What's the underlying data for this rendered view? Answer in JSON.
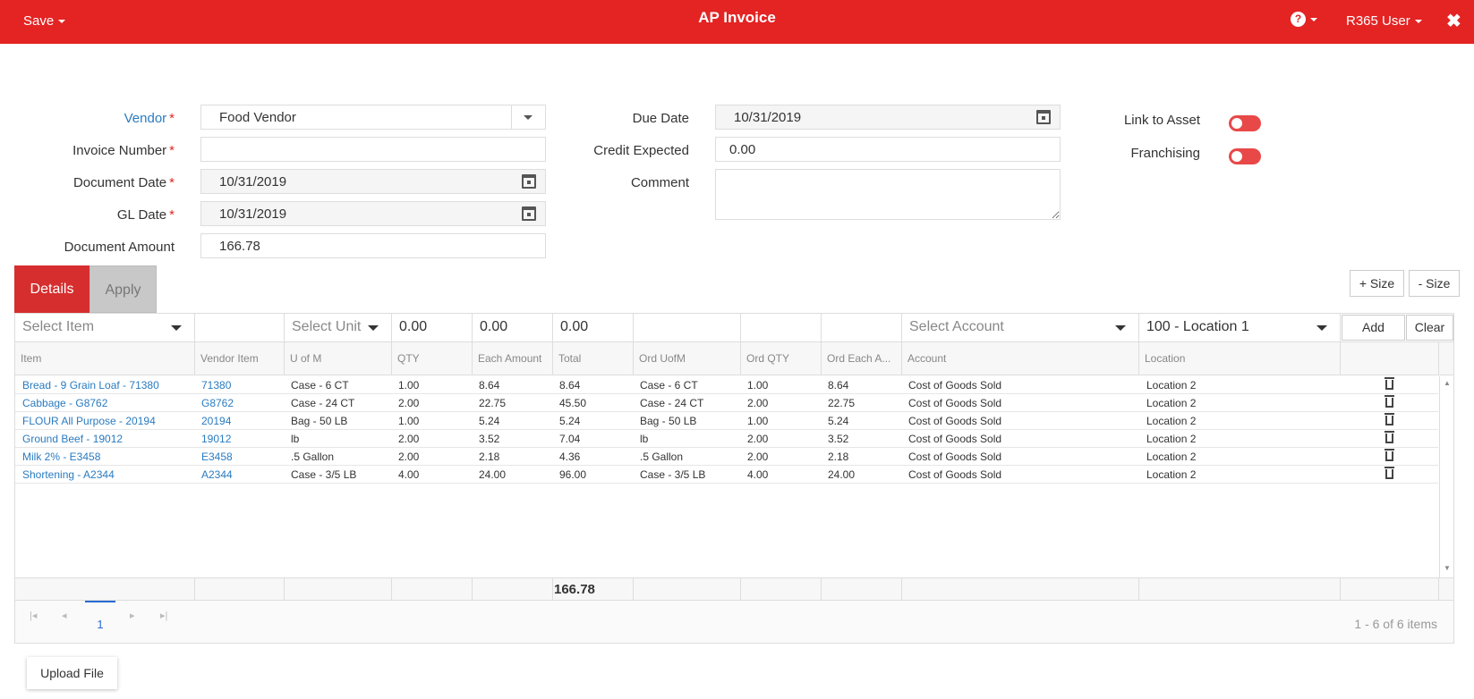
{
  "header": {
    "save_label": "Save",
    "title": "AP Invoice",
    "help_icon": "?",
    "user_label": "R365 User",
    "close_icon": "✖"
  },
  "form": {
    "vendor": {
      "label": "Vendor",
      "value": "Food Vendor"
    },
    "invoice_number": {
      "label": "Invoice Number",
      "value": ""
    },
    "document_date": {
      "label": "Document Date",
      "value": "10/31/2019"
    },
    "gl_date": {
      "label": "GL Date",
      "value": "10/31/2019"
    },
    "document_amount": {
      "label": "Document Amount",
      "value": "166.78"
    },
    "due_date": {
      "label": "Due Date",
      "value": "10/31/2019"
    },
    "credit_expected": {
      "label": "Credit Expected",
      "value": "0.00"
    },
    "comment": {
      "label": "Comment",
      "value": ""
    },
    "link_to_asset": {
      "label": "Link to Asset"
    },
    "franchising": {
      "label": "Franchising"
    },
    "required_mark": "*"
  },
  "tabs": {
    "details": "Details",
    "apply": "Apply"
  },
  "size_buttons": {
    "plus": "+ Size",
    "minus": "- Size"
  },
  "filter_row": {
    "item_placeholder": "Select Item",
    "unit_placeholder": "Select Unit",
    "qty": "0.00",
    "each": "0.00",
    "total": "0.00",
    "account_placeholder": "Select Account",
    "location": "100 - Location 1",
    "add_label": "Add",
    "clear_label": "Clear"
  },
  "columns": [
    "Item",
    "Vendor Item",
    "U of M",
    "QTY",
    "Each Amount",
    "Total",
    "Ord UofM",
    "Ord QTY",
    "Ord Each A...",
    "Account",
    "Location"
  ],
  "rows": [
    {
      "item": "Bread - 9 Grain Loaf - 71380",
      "vendor_item": "71380",
      "uom": "Case - 6 CT",
      "qty": "1.00",
      "each": "8.64",
      "total": "8.64",
      "ord_uom": "Case - 6 CT",
      "ord_qty": "1.00",
      "ord_each": "8.64",
      "account": "Cost of Goods Sold",
      "location": "Location 2"
    },
    {
      "item": "Cabbage - G8762",
      "vendor_item": "G8762",
      "uom": "Case - 24 CT",
      "qty": "2.00",
      "each": "22.75",
      "total": "45.50",
      "ord_uom": "Case - 24 CT",
      "ord_qty": "2.00",
      "ord_each": "22.75",
      "account": "Cost of Goods Sold",
      "location": "Location 2"
    },
    {
      "item": "FLOUR All Purpose - 20194",
      "vendor_item": "20194",
      "uom": "Bag - 50 LB",
      "qty": "1.00",
      "each": "5.24",
      "total": "5.24",
      "ord_uom": "Bag - 50 LB",
      "ord_qty": "1.00",
      "ord_each": "5.24",
      "account": "Cost of Goods Sold",
      "location": "Location 2"
    },
    {
      "item": "Ground Beef - 19012",
      "vendor_item": "19012",
      "uom": "lb",
      "qty": "2.00",
      "each": "3.52",
      "total": "7.04",
      "ord_uom": "lb",
      "ord_qty": "2.00",
      "ord_each": "3.52",
      "account": "Cost of Goods Sold",
      "location": "Location 2"
    },
    {
      "item": "Milk 2% - E3458",
      "vendor_item": "E3458",
      "uom": ".5 Gallon",
      "qty": "2.00",
      "each": "2.18",
      "total": "4.36",
      "ord_uom": ".5 Gallon",
      "ord_qty": "2.00",
      "ord_each": "2.18",
      "account": "Cost of Goods Sold",
      "location": "Location 2"
    },
    {
      "item": "Shortening - A2344",
      "vendor_item": "A2344",
      "uom": "Case - 3/5 LB",
      "qty": "4.00",
      "each": "24.00",
      "total": "96.00",
      "ord_uom": "Case - 3/5 LB",
      "ord_qty": "4.00",
      "ord_each": "24.00",
      "account": "Cost of Goods Sold",
      "location": "Location 2"
    }
  ],
  "footer": {
    "total": "166.78"
  },
  "pager": {
    "current_page": "1",
    "info": "1 - 6 of 6 items"
  },
  "upload_label": "Upload File",
  "colors": {
    "brand": "#e32423",
    "link": "#2a7bc0",
    "tab_active": "#d62e2e"
  },
  "icons": [
    "caret-down-icon",
    "help-icon",
    "close-icon",
    "calendar-icon",
    "trash-icon",
    "first-page-icon",
    "prev-page-icon",
    "next-page-icon",
    "last-page-icon"
  ]
}
